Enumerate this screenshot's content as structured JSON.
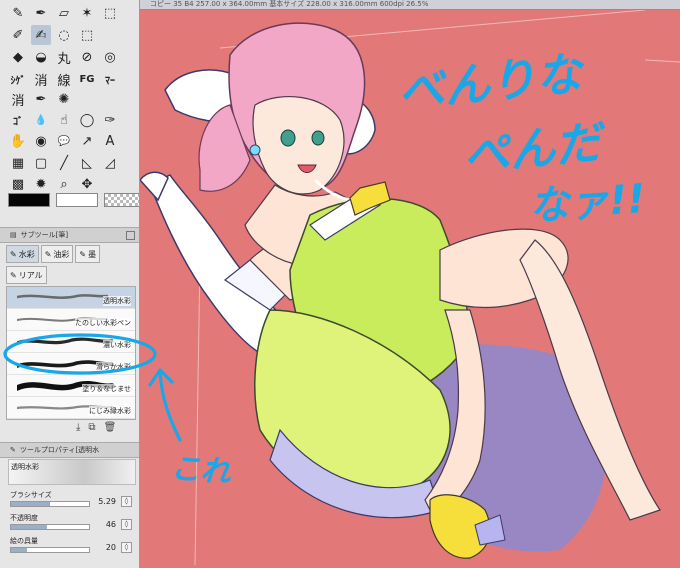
{
  "app": {
    "canvas_title": "コピー 35   B4 257.00 x 364.00mm 基本サイズ 228.00 x 316.00mm 600dpi 26.5%"
  },
  "colors": {
    "canvas_bg": "#e37878",
    "annotation": "#1aa7e8",
    "selection": "#c5d3e4"
  },
  "tool_palette": {
    "rows": [
      [
        {
          "icon": "eyedropper-icon",
          "glyph": "✎"
        },
        {
          "icon": "pen-icon",
          "glyph": "✒"
        },
        {
          "icon": "eraser-icon",
          "glyph": "▱"
        },
        {
          "icon": "magic-wand-icon",
          "glyph": "✶"
        },
        {
          "icon": "selection-icon",
          "glyph": "⬚"
        }
      ],
      [
        {
          "icon": "pencil-icon",
          "glyph": "✐"
        },
        {
          "icon": "brush-icon",
          "glyph": "✍"
        },
        {
          "icon": "lasso-icon",
          "glyph": "◌"
        },
        {
          "icon": "marquee-icon",
          "glyph": "⬚"
        }
      ],
      [
        {
          "icon": "eraser-black-icon",
          "glyph": "◆"
        },
        {
          "icon": "fill-icon",
          "glyph": "◒"
        },
        {
          "icon": "maru-icon",
          "glyph": "丸"
        },
        {
          "icon": "no-pen-icon",
          "glyph": "⊘"
        },
        {
          "icon": "spiral-icon",
          "glyph": "◎"
        }
      ],
      [
        {
          "icon": "shige-icon",
          "glyph": "ｼｹﾞ"
        },
        {
          "icon": "kashou-icon",
          "glyph": "消"
        },
        {
          "icon": "sen-icon",
          "glyph": "線"
        },
        {
          "icon": "fg-icon",
          "glyph": "FG"
        },
        {
          "icon": "marker-icon",
          "glyph": "ﾏｰ"
        }
      ],
      [
        {
          "icon": "sharpen-icon",
          "glyph": "消"
        },
        {
          "icon": "pen-sub-icon",
          "glyph": "✒"
        },
        {
          "icon": "airbrush-icon",
          "glyph": "✺"
        }
      ],
      [
        {
          "icon": "gdrop-icon",
          "glyph": "ｺﾞ"
        },
        {
          "icon": "drops-icon",
          "glyph": "💧"
        },
        {
          "icon": "smudge-icon",
          "glyph": "☝"
        },
        {
          "icon": "balloon-icon",
          "glyph": "◯"
        },
        {
          "icon": "pen2-icon",
          "glyph": "✑"
        }
      ],
      [
        {
          "icon": "blend-icon",
          "glyph": "✋"
        },
        {
          "icon": "drop2-icon",
          "glyph": "◉"
        },
        {
          "icon": "speech-icon",
          "glyph": "💬"
        },
        {
          "icon": "vector-icon",
          "glyph": "↗"
        },
        {
          "icon": "text-icon",
          "glyph": "A"
        }
      ],
      [
        {
          "icon": "gradient-icon",
          "glyph": "▦"
        },
        {
          "icon": "rect-icon",
          "glyph": "▢"
        },
        {
          "icon": "line-icon",
          "glyph": "╱"
        },
        {
          "icon": "ruler-icon",
          "glyph": "◺"
        },
        {
          "icon": "ruler2-icon",
          "glyph": "◿"
        }
      ],
      [
        {
          "icon": "grid-icon",
          "glyph": "▩"
        },
        {
          "icon": "burst-icon",
          "glyph": "✹"
        },
        {
          "icon": "zoom-icon",
          "glyph": "⌕"
        },
        {
          "icon": "move-icon",
          "glyph": "✥"
        }
      ]
    ]
  },
  "subtool": {
    "header": "サブツール[筆]",
    "tabs": [
      "水彩",
      "油彩",
      "墨"
    ],
    "tab2": "リアル",
    "brushes": [
      {
        "label": "透明水彩",
        "selected": true
      },
      {
        "label": "たのしい水彩ペン",
        "selected": false
      },
      {
        "label": "濃い水彩",
        "selected": false
      },
      {
        "label": "滑らか水彩",
        "selected": false
      },
      {
        "label": "塗り＆なじませ",
        "selected": false
      },
      {
        "label": "にじみ縁水彩",
        "selected": false
      }
    ]
  },
  "tool_property": {
    "header": "ツールプロパティ[透明水",
    "brush_name": "透明水彩",
    "rows": [
      {
        "label": "ブラシサイズ",
        "value": "5.29",
        "fraction": 0.5
      },
      {
        "label": "不透明度",
        "value": "46",
        "fraction": 0.46
      },
      {
        "label": "絵の具量",
        "value": "20",
        "fraction": 0.2
      }
    ]
  },
  "annotations": {
    "title_lines": [
      "べんりな",
      "ぺんだ",
      "なァ!!"
    ],
    "pointer_text": "これ"
  }
}
